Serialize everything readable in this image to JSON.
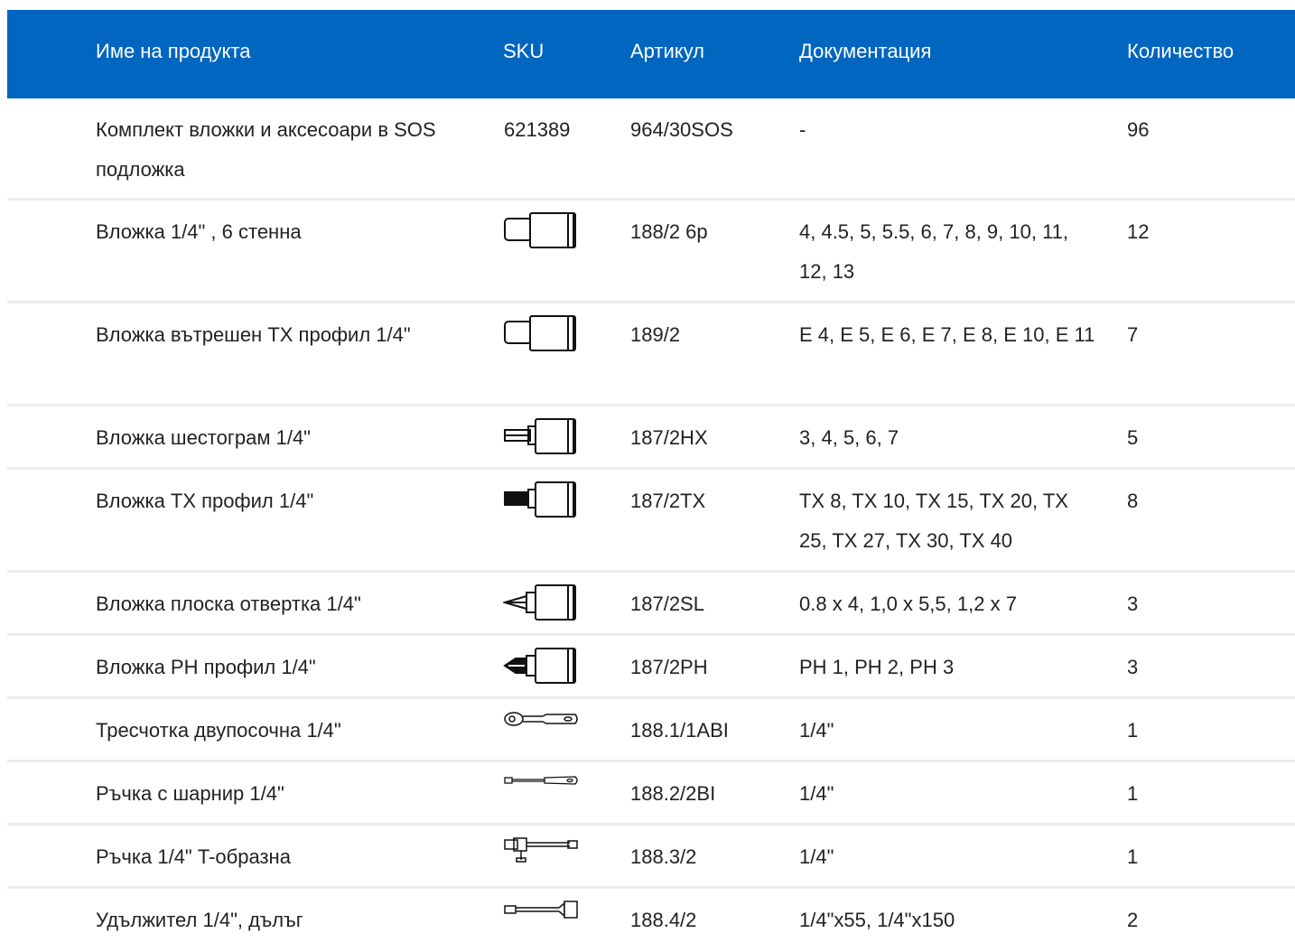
{
  "header": {
    "name": "Име на продукта",
    "sku": "SKU",
    "article": "Артикул",
    "documentation": "Документация",
    "quantity": "Количество"
  },
  "rows": [
    {
      "name": "Комплект вложки и аксесоари в SOS подложка",
      "sku": "621389",
      "icon": null,
      "article": "964/30SOS",
      "documentation": "-",
      "quantity": "96"
    },
    {
      "name": "Вложка 1/4\" , 6 стенна",
      "sku": "",
      "icon": "hex-socket-icon",
      "article": "188/2 6p",
      "documentation": "4, 4.5, 5, 5.5, 6, 7, 8, 9, 10, 11, 12, 13",
      "quantity": "12"
    },
    {
      "name": "Вложка вътрешен TX профил 1/4\"",
      "sku": "",
      "icon": "tx-socket-icon",
      "article": "189/2",
      "documentation": "E 4, E 5, E 6, E 7, E 8, E 10, E 11",
      "quantity": "7"
    },
    {
      "name": "Вложка шестограм 1/4\"",
      "sku": "",
      "icon": "hex-bit-socket-icon",
      "article": "187/2HX",
      "documentation": "3, 4, 5, 6, 7",
      "quantity": "5"
    },
    {
      "name": "Вложка TX профил 1/4\"",
      "sku": "",
      "icon": "tx-bit-socket-icon",
      "article": "187/2TX",
      "documentation": "TX 8, TX 10, TX 15, TX 20, TX 25, TX 27, TX 30, TX 40",
      "quantity": "8"
    },
    {
      "name": "Вложка плоска отвертка 1/4\"",
      "sku": "",
      "icon": "slotted-bit-socket-icon",
      "article": "187/2SL",
      "documentation": "0.8 x 4, 1,0 x 5,5, 1,2 x 7",
      "quantity": "3"
    },
    {
      "name": "Вложка PH профил 1/4\"",
      "sku": "",
      "icon": "phillips-bit-socket-icon",
      "article": "187/2PH",
      "documentation": "PH 1, PH 2, PH 3",
      "quantity": "3"
    },
    {
      "name": "Тресчотка двупосочна 1/4\"",
      "sku": "",
      "icon": "ratchet-icon",
      "article": "188.1/1ABI",
      "documentation": "1/4\"",
      "quantity": "1"
    },
    {
      "name": "Ръчка с шарнир 1/4\"",
      "sku": "",
      "icon": "hinged-handle-icon",
      "article": "188.2/2BI",
      "documentation": "1/4\"",
      "quantity": "1"
    },
    {
      "name": "Ръчка 1/4\" T-образна",
      "sku": "",
      "icon": "t-handle-icon",
      "article": "188.3/2",
      "documentation": "1/4\"",
      "quantity": "1"
    },
    {
      "name": "Удължител 1/4\", дълъг",
      "sku": "",
      "icon": "extension-bar-icon",
      "article": "188.4/2",
      "documentation": "1/4\"x55, 1/4\"x150",
      "quantity": "2"
    }
  ],
  "colors": {
    "header_bg": "#0066bf",
    "header_text": "#ffffff",
    "row_divider": "#ececec"
  }
}
